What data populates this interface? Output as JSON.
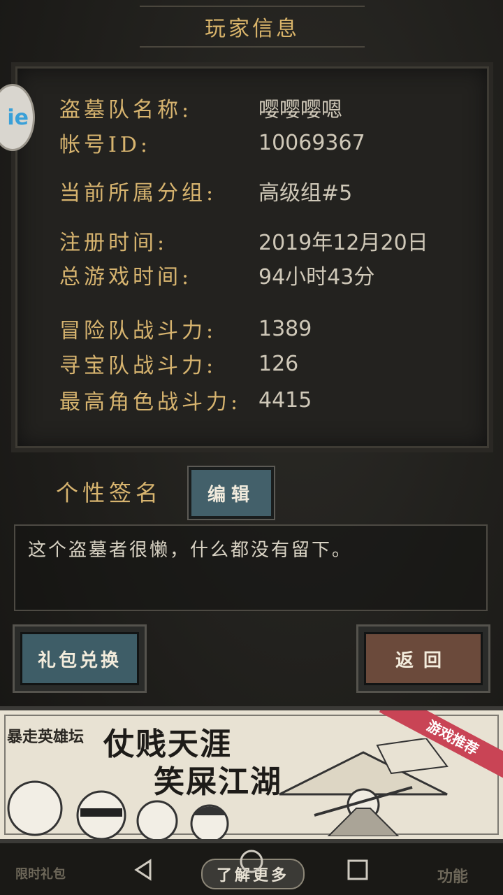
{
  "header": {
    "title": "玩家信息"
  },
  "side_icon": {
    "text": "ie"
  },
  "info": {
    "team_name": {
      "label": "盗墓队名称:",
      "value": "嘤嘤嘤嗯"
    },
    "account_id": {
      "label": "帐号ID:",
      "value": "10069367"
    },
    "group": {
      "label": "当前所属分组:",
      "value": "高级组#5"
    },
    "register_time": {
      "label": "注册时间:",
      "value": "2019年12月20日"
    },
    "total_play_time": {
      "label": "总游戏时间:",
      "value": "94小时43分"
    },
    "adventure_power": {
      "label": "冒险队战斗力:",
      "value": "1389"
    },
    "treasure_power": {
      "label": "寻宝队战斗力:",
      "value": "126"
    },
    "top_role_power": {
      "label": "最高角色战斗力:",
      "value": "4415"
    }
  },
  "signature": {
    "label": "个性签名",
    "edit_label": "编辑",
    "text": "这个盗墓者很懒，什么都没有留下。"
  },
  "buttons": {
    "gift_exchange": "礼包兑换",
    "back": "返回"
  },
  "ad": {
    "logo": "暴走英雄坛",
    "line1": "仗贱天涯",
    "line2": "笑屎江湖",
    "ribbon": "游戏推荐"
  },
  "nav": {
    "left_hint": "限时礼包",
    "learn_more": "了解更多",
    "right_hint": "功能"
  }
}
